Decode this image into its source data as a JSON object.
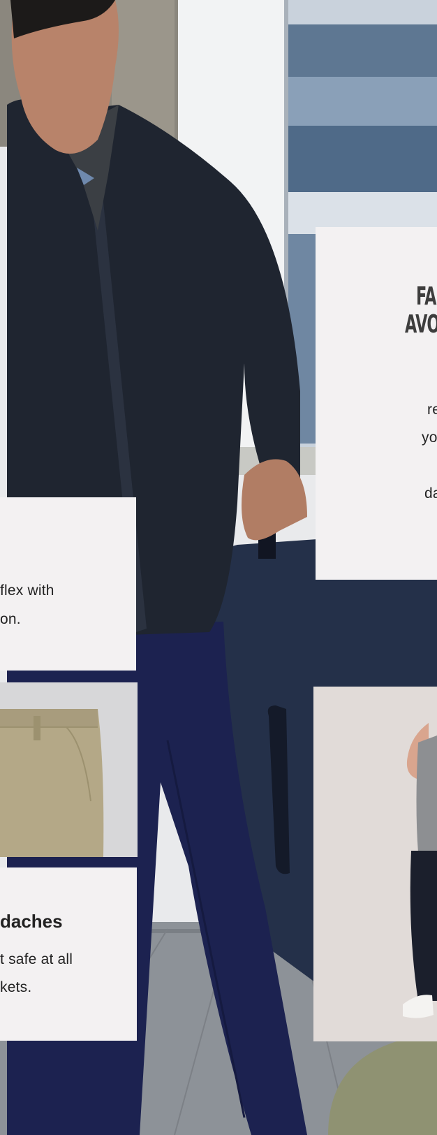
{
  "feature_card_right": {
    "heading_lines": [
      "FA",
      "AVO"
    ],
    "body_lines": [
      "re",
      "yo",
      "da"
    ]
  },
  "feature_card_left": {
    "body_lines": [
      "flex with",
      "on."
    ]
  },
  "feature_card_bottom": {
    "heading": "daches",
    "body_lines": [
      "t safe at all",
      "kets."
    ]
  },
  "colors": {
    "card_background": "#f3f1f2",
    "jacket": "#1f2530",
    "pants": "#1c2250",
    "suitcase": "#243049",
    "chino": "#b4a887"
  }
}
